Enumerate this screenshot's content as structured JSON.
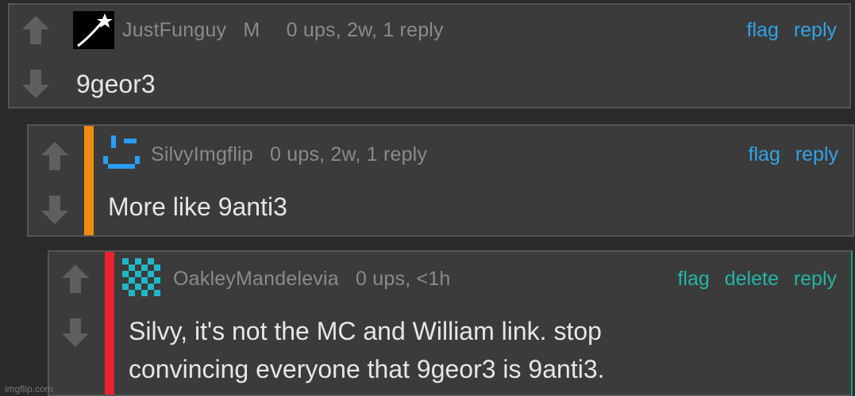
{
  "comments": [
    {
      "username": "JustFunguy",
      "badge": "M",
      "stats": "0 ups, 2w, 1 reply",
      "text": "9geor3",
      "actions": {
        "flag": "flag",
        "reply": "reply"
      },
      "action_color": "#2fa3e6"
    },
    {
      "username": "SilvyImgflip",
      "stats": "0 ups, 2w, 1 reply",
      "text": "More like 9anti3",
      "actions": {
        "flag": "flag",
        "reply": "reply"
      },
      "action_color": "#2fa3e6",
      "stripe_color": "#f08c14"
    },
    {
      "username": "OakleyMandelevia",
      "stats": "0 ups, <1h",
      "text_line1": "Silvy, it's not the MC and William link. stop",
      "text_line2": "convincing everyone that 9geor3 is 9anti3.",
      "actions": {
        "flag": "flag",
        "delete": "delete",
        "reply": "reply"
      },
      "action_color": "#22b5a6",
      "stripe_color": "#e8222e"
    }
  ],
  "watermark": "imgflip.com",
  "colors": {
    "background": "#2a2a2a",
    "panel": "#3b3b3b",
    "vote_arrow": "#5f5f5f"
  }
}
